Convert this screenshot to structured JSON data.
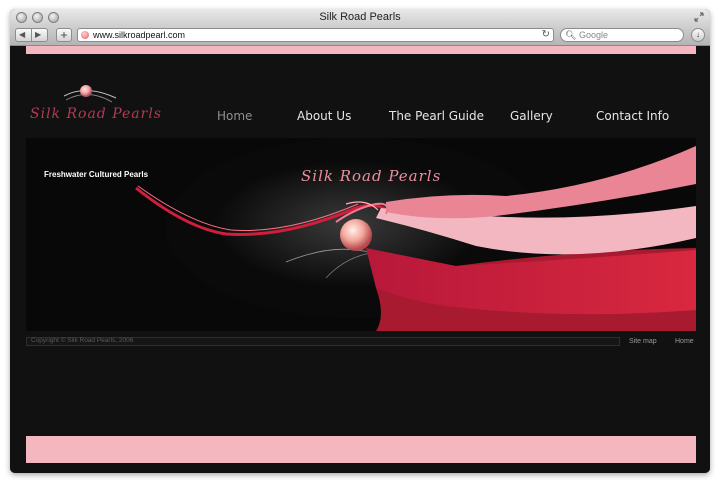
{
  "window": {
    "title": "Silk Road Pearls"
  },
  "toolbar": {
    "back_glyph": "◀",
    "forward_glyph": "▶",
    "add_glyph": "+",
    "url": "www.silkroadpearl.com",
    "reload_glyph": "↻",
    "search_placeholder": "Google",
    "search_glyph": "🔍︎",
    "download_glyph": "↓"
  },
  "site": {
    "logo_text": "Silk Road Pearls",
    "nav": [
      {
        "label": "Home",
        "active": true
      },
      {
        "label": "About Us",
        "active": false
      },
      {
        "label": "The Pearl Guide",
        "active": false
      },
      {
        "label": "Gallery",
        "active": false
      },
      {
        "label": "Contact Info",
        "active": false
      }
    ],
    "banner": {
      "caption": "Freshwater Cultured Pearls",
      "title": "Silk Road Pearls"
    },
    "footer": {
      "copyright": "Copyright © Silk Road Pearls, 2006",
      "links": [
        "Site map",
        "Home"
      ]
    }
  },
  "colors": {
    "page_bg": "#111111",
    "accent_pink": "#f4b7c0",
    "ribbon_red": "#d42a3f",
    "ribbon_rose": "#e98595"
  }
}
